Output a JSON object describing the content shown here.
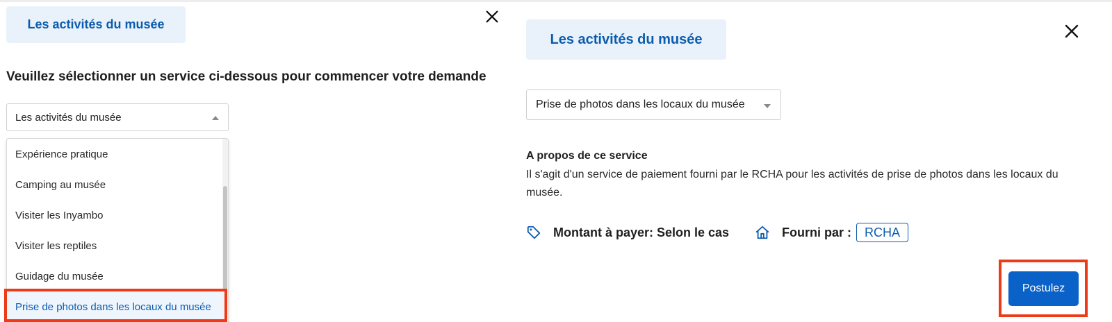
{
  "left_panel": {
    "category_chip": "Les activités du musée",
    "instructions": "Veuillez sélectionner un service ci-dessous pour commencer votre demande",
    "category_select": {
      "value": "Les activités du musée"
    },
    "options": [
      {
        "label": "Expérience pratique"
      },
      {
        "label": "Camping au musée"
      },
      {
        "label": "Visiter les Inyambo"
      },
      {
        "label": "Visiter les reptiles"
      },
      {
        "label": "Guidage du musée"
      },
      {
        "label": "Prise de photos dans les locaux du musée",
        "selected": true
      }
    ]
  },
  "right_panel": {
    "category_chip": "Les activités du musée",
    "service_select": {
      "value": "Prise de photos dans les locaux du musée"
    },
    "about": {
      "title": "A propos de ce service",
      "text": "Il s'agit d'un service de paiement fourni par le RCHA pour les activités de prise de photos dans les locaux du musée."
    },
    "amount": {
      "icon": "price-tag-icon",
      "label": "Montant à payer: Selon le cas"
    },
    "provider": {
      "icon": "home-icon",
      "label": "Fourni par :",
      "name": "RCHA"
    },
    "apply_button": "Postulez"
  },
  "colors": {
    "accent": "#0b5cad",
    "button": "#0a62c9",
    "chip_bg": "#e9f2fb",
    "highlight": "#ee3a16"
  }
}
